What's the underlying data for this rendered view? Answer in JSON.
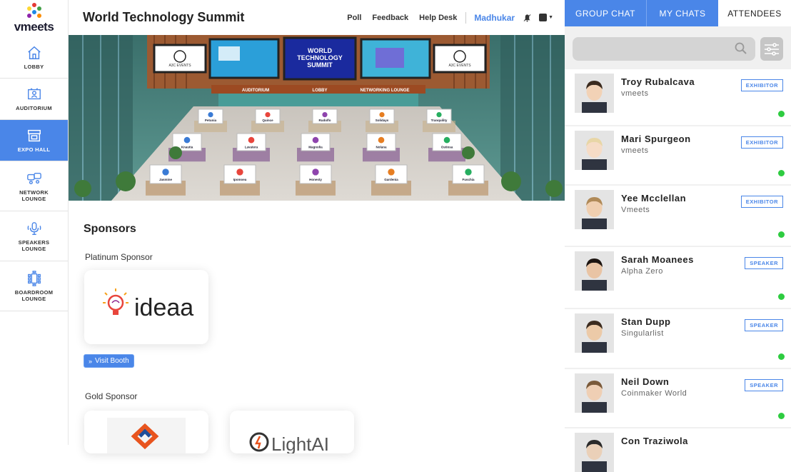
{
  "brand": {
    "name": "vmeets"
  },
  "nav": {
    "items": [
      {
        "label": "LOBBY",
        "icon": "home-icon"
      },
      {
        "label": "AUDITORIUM",
        "icon": "auditorium-icon"
      },
      {
        "label": "EXPO HALL",
        "icon": "booth-icon",
        "active": true
      },
      {
        "label": "NETWORK\nLOUNGE",
        "icon": "network-lounge-icon"
      },
      {
        "label": "SPEAKERS\nLOUNGE",
        "icon": "microphone-icon"
      },
      {
        "label": "BOARDROOM\nLOUNGE",
        "icon": "boardroom-icon"
      }
    ]
  },
  "header": {
    "title": "World Technology Summit",
    "links": [
      "Poll",
      "Feedback",
      "Help Desk"
    ],
    "user": "Madhukar"
  },
  "banner": {
    "screen_center": "WORLD TECHNOLOGY SUMMIT",
    "screen_logo": "A3C EVENTS",
    "signs": [
      "AUDITORIUM",
      "LOBBY",
      "NETWORKING LOUNGE"
    ],
    "booths": [
      "Petunia",
      "Quince",
      "Rudolfo",
      "Solidays",
      "Tranquility",
      "Knautia",
      "Lavatera",
      "Magnolia",
      "Nolana",
      "Ostiosa",
      "Jasmine",
      "Ipomoea",
      "Honesty",
      "Gardenia",
      "Fuschia"
    ]
  },
  "sponsors": {
    "title": "Sponsors",
    "platinum_label": "Platinum Sponsor",
    "platinum_logo_text": "ideaa",
    "visit_booth_label": "Visit Booth",
    "gold_label": "Gold Sponsor",
    "gold_second_logo_text": "LightAI"
  },
  "right_panel": {
    "tabs": [
      "GROUP CHAT",
      "MY CHATS",
      "ATTENDEES"
    ],
    "search_placeholder": "",
    "attendees": [
      {
        "name": "Troy Rubalcava",
        "company": "vmeets",
        "role": "EXHIBITOR",
        "online": true
      },
      {
        "name": "Mari Spurgeon",
        "company": "vmeets",
        "role": "EXHIBITOR",
        "online": true
      },
      {
        "name": "Yee Mcclellan",
        "company": "Vmeets",
        "role": "EXHIBITOR",
        "online": true
      },
      {
        "name": "Sarah Moanees",
        "company": "Alpha Zero",
        "role": "SPEAKER",
        "online": true
      },
      {
        "name": "Stan Dupp",
        "company": "Singularlist",
        "role": "SPEAKER",
        "online": true
      },
      {
        "name": "Neil Down",
        "company": "Coinmaker World",
        "role": "SPEAKER",
        "online": true
      },
      {
        "name": "Con Traziwola",
        "company": "",
        "role": "",
        "online": false
      }
    ]
  },
  "colors": {
    "accent": "#4a86e8",
    "online": "#2ecc40"
  }
}
